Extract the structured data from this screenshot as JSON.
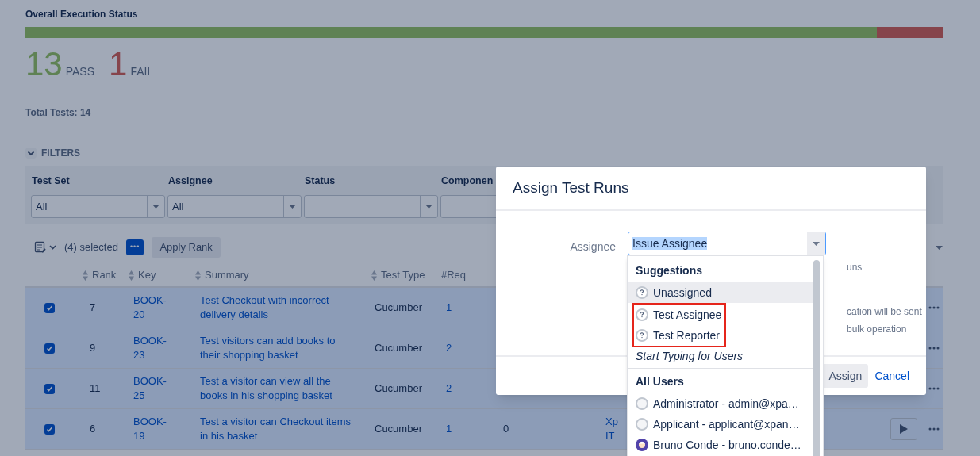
{
  "execution_status": {
    "title": "Overall Execution Status",
    "pass_bar": {
      "level": 0.9286
    },
    "segments": [
      {
        "kind": "pass",
        "count": "13",
        "label": "PASS"
      },
      {
        "kind": "fail",
        "count": "1",
        "label": "FAIL"
      }
    ],
    "total": "Total Tests: 14"
  },
  "filters": {
    "title": "FILTERS",
    "expanded": true,
    "fields": [
      {
        "label": "Test Set",
        "value": "All"
      },
      {
        "label": "Assignee",
        "value": "All"
      },
      {
        "label": "Status"
      },
      {
        "label": "Componen"
      }
    ]
  },
  "toolbar": {
    "selected_count": "(4) selected",
    "more_button": "•••",
    "apply_rank": "Apply Rank"
  },
  "table": {
    "columns": [
      "Rank",
      "Key",
      "Summary",
      "Test Type",
      "#Req"
    ],
    "rows": [
      {
        "checked": true,
        "rank": "7",
        "key": "BOOK-20",
        "summary": "Test Checkout with incorrect delivery details",
        "test_type": "Cucumber",
        "req": "1"
      },
      {
        "checked": true,
        "rank": "9",
        "key": "BOOK-23",
        "summary": "Test visitors can add books to their shopping basket",
        "test_type": "Cucumber",
        "req": "2"
      },
      {
        "checked": true,
        "rank": "11",
        "key": "BOOK-25",
        "summary": "Test a visitor can view all the books in his shopping basket",
        "test_type": "Cucumber",
        "req": "2"
      },
      {
        "checked": true,
        "rank": "6",
        "key": "BOOK-19",
        "summary": "Test a visitor can Checkout items in his basket",
        "test_type": "Cucumber",
        "req": "1",
        "column_7": "0",
        "column_8": [
          "Xp",
          "IT"
        ],
        "play": true
      }
    ]
  },
  "modal": {
    "title": "Assign Test Runs",
    "field_label": "Assignee",
    "field_value": "Issue Assignee",
    "notes": [
      "uns",
      "cation will be sent",
      "bulk operation"
    ],
    "buttons": [
      {
        "kind": "primary",
        "label": "Assign"
      },
      {
        "kind": "link",
        "label": "Cancel"
      }
    ]
  },
  "dropdown": {
    "groups": [
      {
        "heading": "Suggestions",
        "items": [
          {
            "label": "Unassigned",
            "kind": "unknown",
            "selected": true,
            "highlighted": false
          },
          {
            "label": "Test Assignee",
            "kind": "unknown",
            "selected": false,
            "highlighted": true
          },
          {
            "label": "Test Reporter",
            "kind": "unknown",
            "selected": false,
            "highlighted": true
          }
        ],
        "hint": "Start Typing for Users"
      },
      {
        "heading": "All Users",
        "items": [
          {
            "label": "Administrator - admin@xpa…",
            "kind": "default",
            "selected": false,
            "highlighted": false
          },
          {
            "label": "Applicant - applicant@xpan…",
            "kind": "default",
            "selected": false,
            "highlighted": false
          },
          {
            "label": "Bruno Conde - bruno.conde…",
            "kind": "photo",
            "selected": false,
            "highlighted": false
          }
        ]
      }
    ]
  }
}
